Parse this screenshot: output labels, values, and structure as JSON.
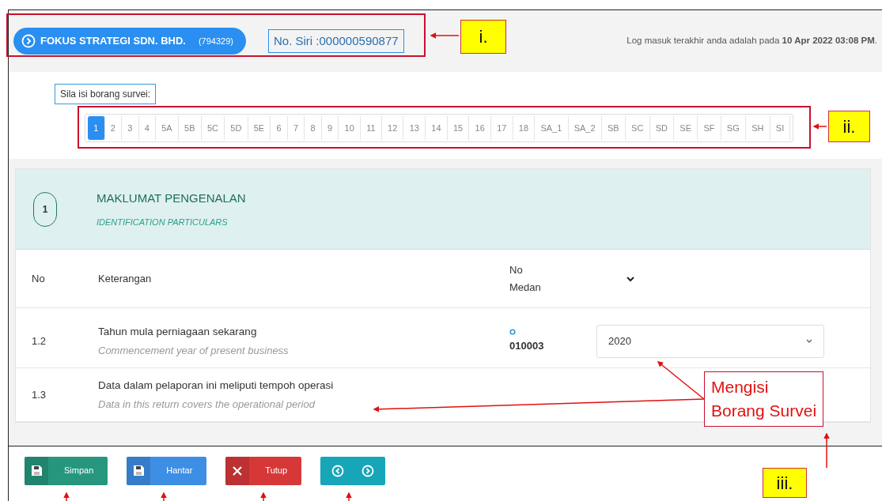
{
  "header": {
    "company": "FOKUS STRATEGI SDN. BHD.",
    "company_no": "(794329)",
    "serial": "No. Siri :000000590877",
    "last_login": "Log masuk terakhir anda adalah pada **10 Apr 2022 03:08 PM**."
  },
  "survey": {
    "prompt": "Sila isi borang survei:",
    "tabs": [
      {
        "label": "1",
        "selected": true
      },
      {
        "label": "2",
        "selected": false
      },
      {
        "label": "3",
        "selected": false
      },
      {
        "label": "4",
        "selected": false
      },
      {
        "label": "5A",
        "selected": false
      },
      {
        "label": "5B",
        "selected": false
      },
      {
        "label": "5C",
        "selected": false
      },
      {
        "label": "5D",
        "selected": false
      },
      {
        "label": "5E",
        "selected": false
      },
      {
        "label": "6",
        "selected": false
      },
      {
        "label": "7",
        "selected": false
      },
      {
        "label": "8",
        "selected": false
      },
      {
        "label": "9",
        "selected": false
      },
      {
        "label": "10",
        "selected": false
      },
      {
        "label": "11",
        "selected": false
      },
      {
        "label": "12",
        "selected": false
      },
      {
        "label": "13",
        "selected": false
      },
      {
        "label": "14",
        "selected": false
      },
      {
        "label": "15",
        "selected": false
      },
      {
        "label": "16",
        "selected": false
      },
      {
        "label": "17",
        "selected": false
      },
      {
        "label": "18",
        "selected": false
      },
      {
        "label": "SA_1",
        "selected": false
      },
      {
        "label": "SA_2",
        "selected": false
      },
      {
        "label": "SB",
        "selected": false
      },
      {
        "label": "SC",
        "selected": false
      },
      {
        "label": "SD",
        "selected": false
      },
      {
        "label": "SE",
        "selected": false
      },
      {
        "label": "SF",
        "selected": false
      },
      {
        "label": "SG",
        "selected": false
      },
      {
        "label": "SH",
        "selected": false
      },
      {
        "label": "SI",
        "selected": false
      }
    ]
  },
  "section": {
    "number": "1",
    "title": "MAKLUMAT PENGENALAN",
    "subtitle": "IDENTIFICATION PARTICULARS",
    "columns": [
      "No",
      "Keterangan",
      "No\nMedan"
    ],
    "rows": [
      {
        "no": "1.2",
        "label": "Tahun mula perniagaan sekarang",
        "label_en": "Commencement year of present business",
        "field_no": "010003",
        "value": "2020"
      },
      {
        "no": "1.3",
        "label": "Data dalam pelaporan ini meliputi tempoh operasi",
        "label_en": "Data in this return covers the operational period"
      }
    ]
  },
  "buttons": [
    {
      "kind": "save",
      "label": "Simpan"
    },
    {
      "kind": "send",
      "label": "Hantar"
    },
    {
      "kind": "close",
      "label": "Tutup"
    },
    {
      "kind": "nav"
    }
  ],
  "annotations": {
    "labels": [
      "i.",
      "ii.",
      "iii."
    ],
    "callout": "Mengisi\nBorang Survei"
  }
}
